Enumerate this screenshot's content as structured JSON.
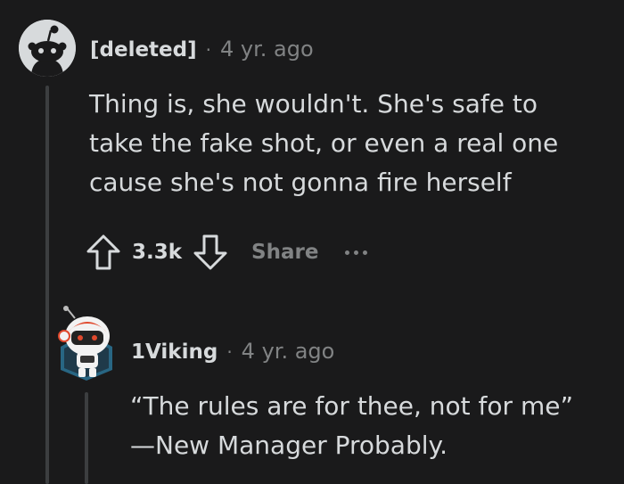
{
  "comments": [
    {
      "author": "[deleted]",
      "separator": "·",
      "time": "4 yr. ago",
      "avatar": "reddit-snoo-default-icon",
      "body": "Thing is, she wouldn't. She's safe to\ntake the fake shot, or even a real one\ncause she's not gonna fire herself",
      "actions": {
        "upvote_icon": "arrow-up-outline-icon",
        "score": "3.3k",
        "downvote_icon": "arrow-down-outline-icon",
        "share_label": "Share",
        "more_icon": "ellipsis-icon"
      }
    },
    {
      "author": "1Viking",
      "separator": "·",
      "time": "4 yr. ago",
      "avatar": "snoo-avatar-helmet-icon",
      "body": "“The rules are for thee, not for me”\n—New Manager Probably."
    }
  ],
  "colors": {
    "background": "#1a1a1b",
    "text": "#d7dadc",
    "muted": "#818384",
    "thread_line": "#3c3e40"
  }
}
